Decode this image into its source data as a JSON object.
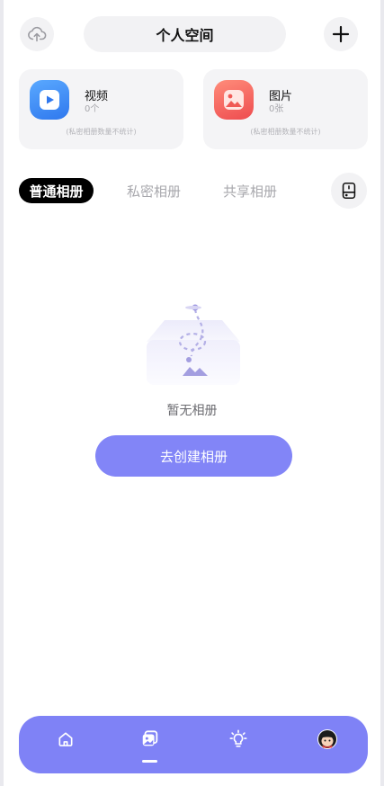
{
  "header": {
    "title": "个人空间",
    "upload_icon": "cloud-upload-icon",
    "add_icon": "plus-icon"
  },
  "cards": [
    {
      "title": "视频",
      "count": "0个",
      "note": "(私密相册数量不统计)",
      "icon": "video-play-icon",
      "color": "#3f8cf5"
    },
    {
      "title": "图片",
      "count": "0张",
      "note": "(私密相册数量不统计)",
      "icon": "image-icon",
      "color": "#f4665f"
    }
  ],
  "tabs": [
    {
      "label": "普通相册",
      "active": true
    },
    {
      "label": "私密相册",
      "active": false
    },
    {
      "label": "共享相册",
      "active": false
    }
  ],
  "tabs_right_icon": "storage-drive-icon",
  "empty_state": {
    "illustration": "empty-tray-illustration",
    "text": "暂无相册",
    "button_label": "去创建相册"
  },
  "bottom_nav": {
    "items": [
      "home-icon",
      "album-icon",
      "lightbulb-icon",
      "avatar"
    ],
    "active_index": 1
  },
  "colors": {
    "accent": "#8285f7",
    "nav_bg": "#7f82f6",
    "tab_active_bg": "#000000"
  }
}
